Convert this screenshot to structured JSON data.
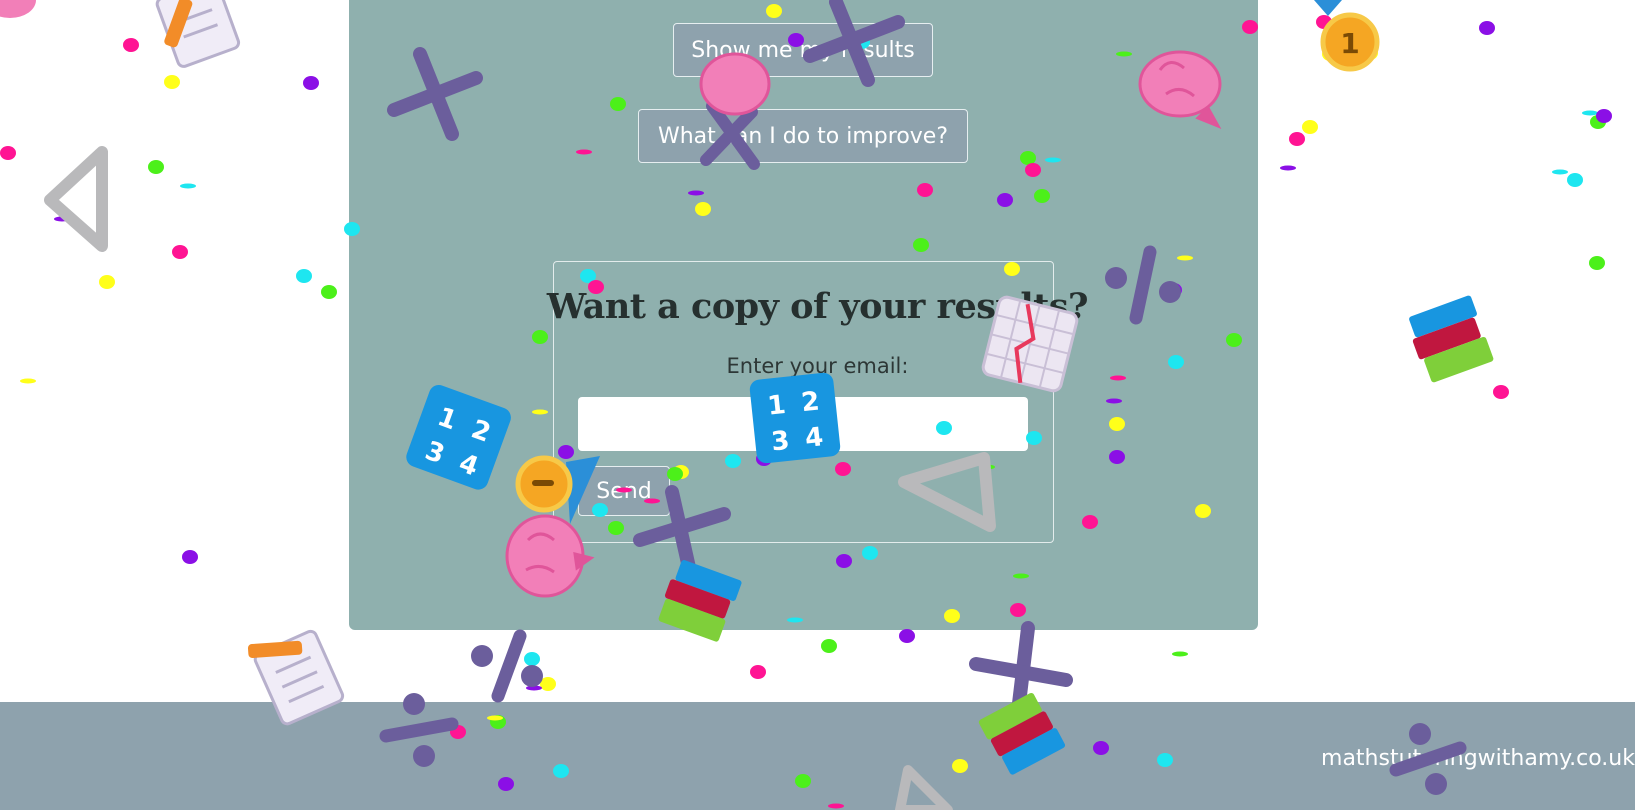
{
  "results": {
    "show_label": "Show me my results",
    "improve_label": "What can I do to improve?"
  },
  "copy": {
    "title": "Want a copy of your results?",
    "email_label": "Enter your email:",
    "email_value": "",
    "email_placeholder": "",
    "send_label": "Send"
  },
  "footer": {
    "site": "mathstutoringwithamy.co.uk"
  },
  "celebration": {
    "icons": [
      "multiply-icon",
      "brain-icon",
      "percent-icon",
      "set-square-icon",
      "medal-icon",
      "number-blocks-icon",
      "books-icon",
      "notepad-pencil-icon",
      "graph-paper-icon"
    ],
    "colors": {
      "panel": "#8fb0ae",
      "footer": "#8ea2ad",
      "symbol": "#6b5e9c",
      "confetti": [
        "#ff1493",
        "#ffff1a",
        "#8b0fe6",
        "#1ee6f0",
        "#4cf01a"
      ]
    }
  }
}
